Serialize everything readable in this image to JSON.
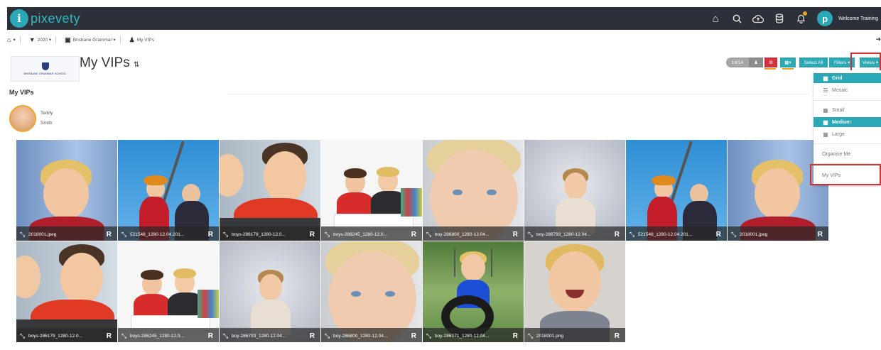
{
  "brand": {
    "mark": "i",
    "name": "pixevety"
  },
  "topbar": {
    "icons": [
      "home-icon",
      "search-icon",
      "cloud-upload-icon",
      "database-icon",
      "bell-icon"
    ],
    "user_mark": "p",
    "welcome": "Welcome Training"
  },
  "breadcrumb": {
    "home_icon": "home-icon",
    "filter_icon": "filter-icon",
    "year": "2020",
    "school_icon": "building-icon",
    "school": "Brisbane Grammar",
    "group_icon": "people-icon",
    "group": "My VIPs",
    "back_icon": "arrow-right-icon"
  },
  "header": {
    "school_logo_text": "BRISBANE GRAMMAR SCHOOL",
    "title": "My VIPs",
    "sort_icon": "sort-icon"
  },
  "toolbar": {
    "count": "14/14",
    "select_all": "Select All",
    "filters": "Filters",
    "views": "Views"
  },
  "views_menu": {
    "grid": "Grid",
    "mosaic": "Mosaic",
    "small": "Small",
    "medium": "Medium",
    "large": "Large",
    "organise": "Organise Me",
    "my_vips": "My VIPs"
  },
  "vip_section": {
    "label": "My VIPs",
    "person": {
      "first": "Teddy",
      "last": "Smith"
    }
  },
  "photos": [
    {
      "name": "2018001.jpeg",
      "badge": "R"
    },
    {
      "name": "521548_1280-12.04.201...",
      "badge": "R"
    },
    {
      "name": "boys-286179_1280-12.0...",
      "badge": "R"
    },
    {
      "name": "boys-286245_1280-12.0...",
      "badge": "R"
    },
    {
      "name": "boy-286800_1280-12.04...",
      "badge": "R"
    },
    {
      "name": "boy-286793_1280-12.04...",
      "badge": "R"
    },
    {
      "name": "521548_1280-12.04.201...",
      "badge": "R"
    },
    {
      "name": "2018001.jpeg",
      "badge": "R"
    },
    {
      "name": "boys-286179_1280-12.0...",
      "badge": "R"
    },
    {
      "name": "boys-286245_1280-12.0...",
      "badge": "R"
    },
    {
      "name": "boy-286793_1280-12.04...",
      "badge": "R"
    },
    {
      "name": "boy-286800_1280-12.04...",
      "badge": "R"
    },
    {
      "name": "boy-286171_1280-12.04...",
      "badge": "R"
    },
    {
      "name": "2018001.png",
      "badge": "R"
    }
  ],
  "colors": {
    "topbar": "#2c3038",
    "accent": "#2aa8b5",
    "highlight": "#d43030",
    "warning": "#f0a52a"
  }
}
